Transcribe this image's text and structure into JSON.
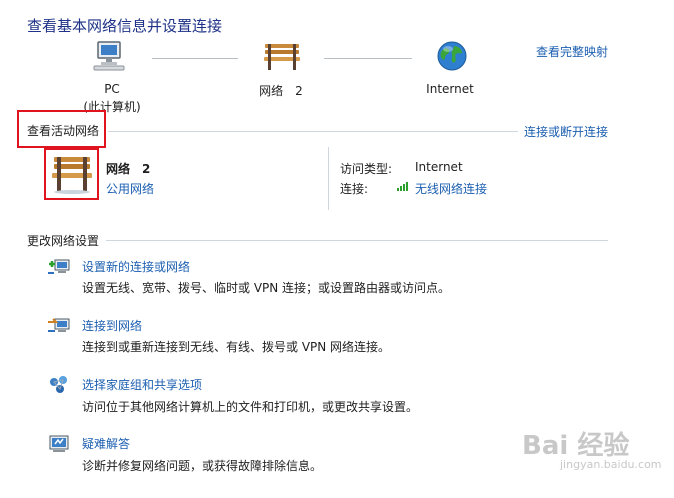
{
  "header": {
    "title": "查看基本网络信息并设置连接",
    "view_full_map": "查看完整映射"
  },
  "map": {
    "pc_label": "PC",
    "pc_sublabel": "(此计算机)",
    "network_label": "网络　2",
    "internet_label": "Internet"
  },
  "active": {
    "section_title": "查看活动网络",
    "connect_disconnect": "连接或断开连接",
    "network_name": "网络　2",
    "network_type": "公用网络",
    "access_type_label": "访问类型:",
    "access_type_value": "Internet",
    "connections_label": "连接:",
    "connections_value": "无线网络连接"
  },
  "settings": {
    "section_title": "更改网络设置",
    "tasks": [
      {
        "title": "设置新的连接或网络",
        "desc": "设置无线、宽带、拨号、临时或 VPN 连接；或设置路由器或访问点。"
      },
      {
        "title": "连接到网络",
        "desc": "连接到或重新连接到无线、有线、拨号或 VPN 网络连接。"
      },
      {
        "title": "选择家庭组和共享选项",
        "desc": "访问位于其他网络计算机上的文件和打印机，或更改共享设置。"
      },
      {
        "title": "疑难解答",
        "desc": "诊断并修复网络问题，或获得故障排除信息。"
      }
    ]
  },
  "watermark": {
    "brand": "Bai 经验",
    "url": "jingyan.baidu.com"
  },
  "colors": {
    "link": "#1c5fb0",
    "title": "#1e3287",
    "highlight": "#e0141e"
  }
}
